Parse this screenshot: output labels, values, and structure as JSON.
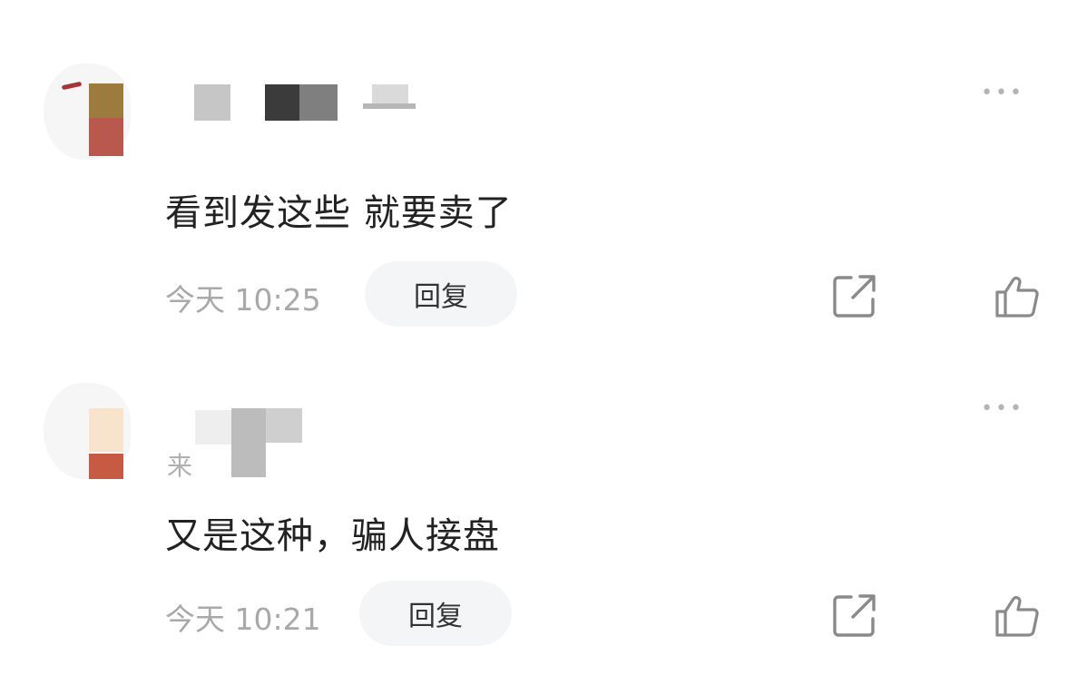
{
  "comments": [
    {
      "username": "",
      "source": "",
      "text": "看到发这些 就要卖了",
      "time": "今天 10:25",
      "reply_label": "回复",
      "more_label": "•••"
    },
    {
      "username": "",
      "source": "来",
      "text": "又是这种，骗人接盘",
      "time": "今天 10:21",
      "reply_label": "回复",
      "more_label": "•••"
    }
  ],
  "icons": {
    "share": "share-icon",
    "like": "thumbs-up-icon",
    "more": "more-icon"
  },
  "colors": {
    "text_primary": "#222222",
    "text_secondary": "#a9a9a9",
    "reply_bg": "#f4f5f7",
    "icon": "#8a8a8a"
  }
}
